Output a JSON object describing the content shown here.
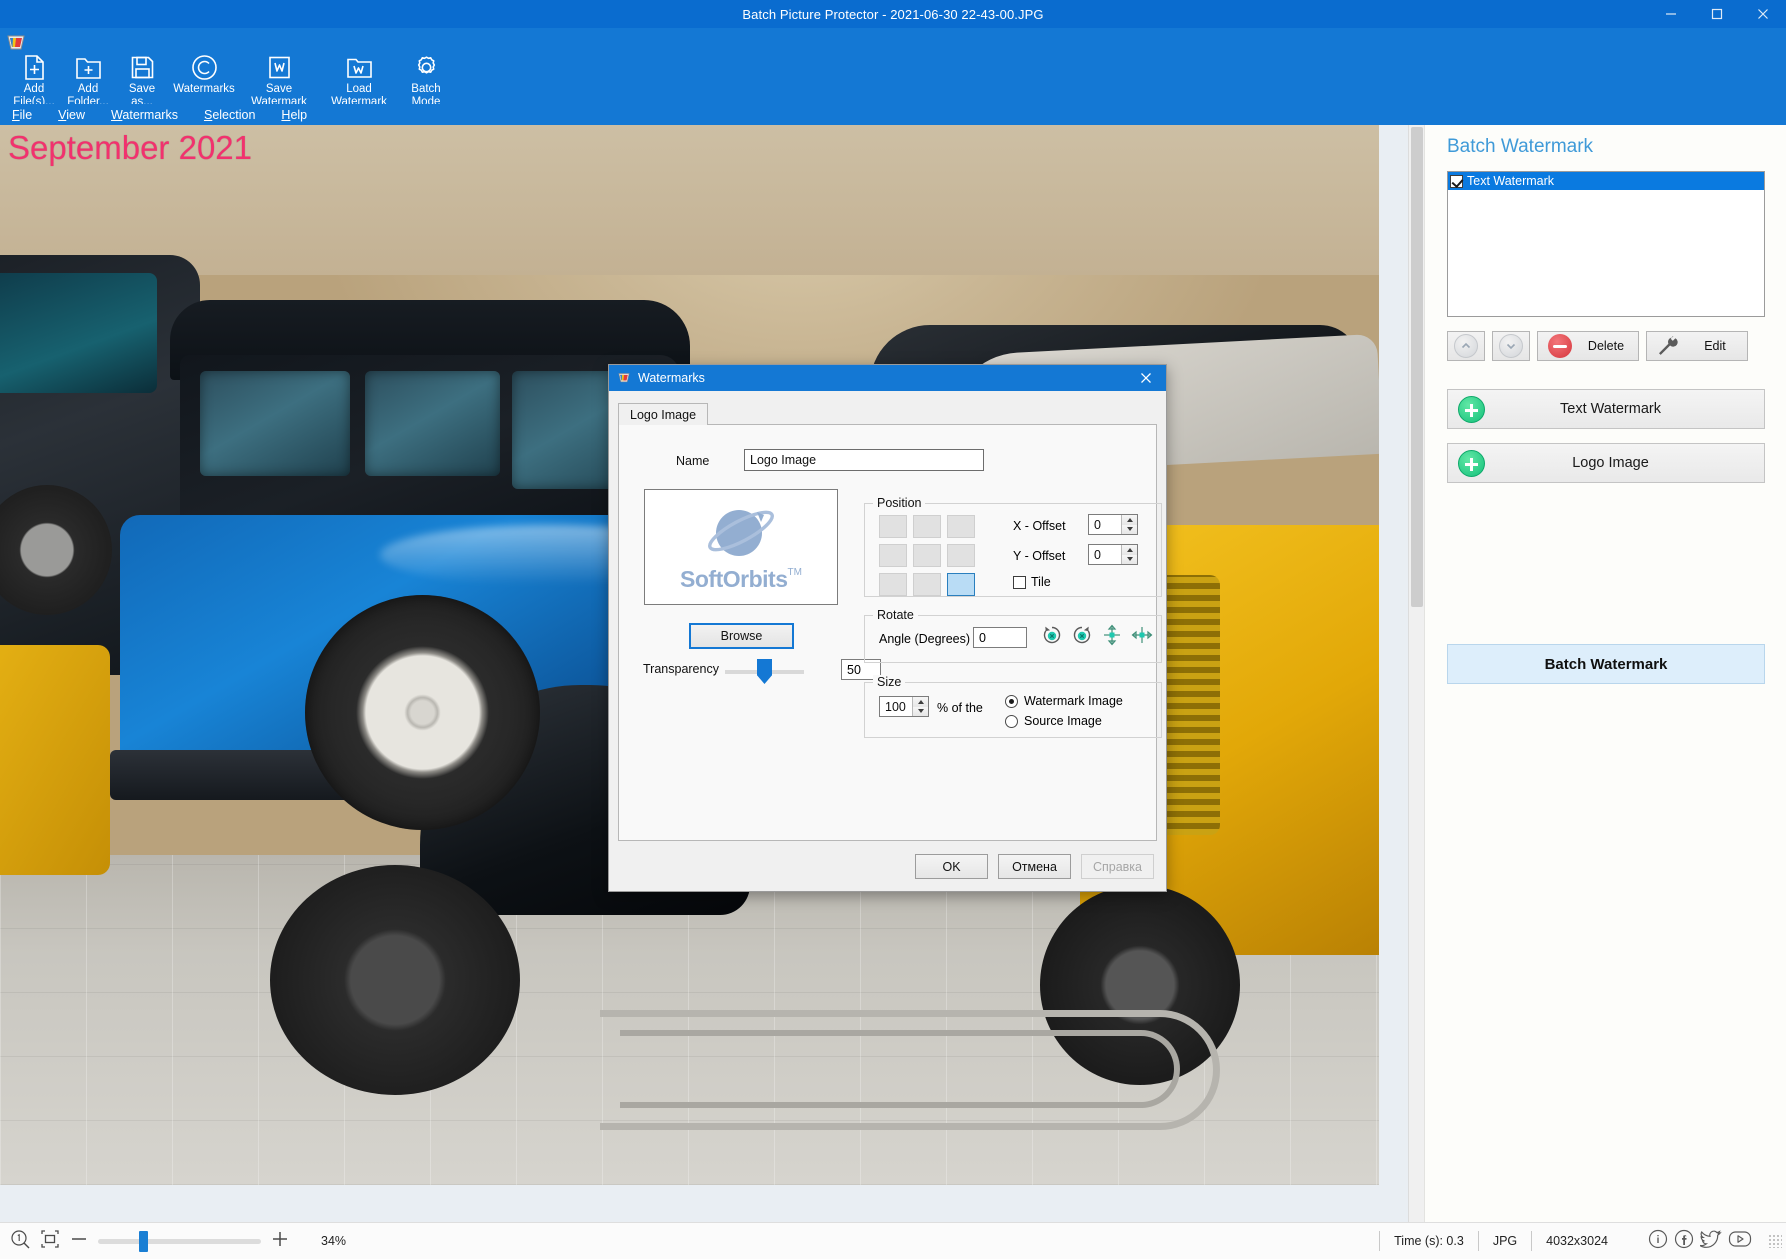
{
  "window": {
    "title": "Batch Picture Protector - 2021-06-30 22-43-00.JPG",
    "app_icon": "app-logo-icon",
    "minimize": "minimize-icon",
    "maximize": "maximize-icon",
    "close": "close-icon"
  },
  "toolbar": {
    "items": [
      {
        "icon": "add-file-icon",
        "label": "Add\nFile(s)..."
      },
      {
        "icon": "add-folder-icon",
        "label": "Add\nFolder..."
      },
      {
        "icon": "save-as-icon",
        "label": "Save\nas..."
      },
      {
        "icon": "copyright-icon",
        "label": "Watermarks"
      },
      {
        "icon": "save-watermark-icon",
        "label": "Save\nWatermark"
      },
      {
        "icon": "load-watermark-icon",
        "label": "Load\nWatermark"
      },
      {
        "icon": "gear-icon",
        "label": "Batch\nMode"
      }
    ]
  },
  "menubar": {
    "items": [
      "File",
      "View",
      "Watermarks",
      "Selection",
      "Help"
    ]
  },
  "canvas": {
    "watermark_overlay_text": "September 2021",
    "watermark_overlay_color": "#f2316e"
  },
  "sidebar": {
    "title": "Batch Watermark",
    "list": [
      {
        "label": "Text Watermark",
        "checked": true,
        "selected": true
      }
    ],
    "list_buttons": [
      {
        "name": "move-up-button",
        "icon": "chevron-up-icon",
        "label": ""
      },
      {
        "name": "move-down-button",
        "icon": "chevron-down-icon",
        "label": ""
      },
      {
        "name": "delete-button",
        "icon": "minus-circle-icon",
        "label": "Delete"
      },
      {
        "name": "edit-button",
        "icon": "wrench-icon",
        "label": "Edit"
      }
    ],
    "add_buttons": [
      {
        "label": "Text Watermark",
        "icon": "plus-circle-icon"
      },
      {
        "label": "Logo Image",
        "icon": "plus-circle-icon"
      }
    ],
    "batch_button": "Batch Watermark"
  },
  "dialog": {
    "title": "Watermarks",
    "icon": "app-logo-icon",
    "close": "close-icon",
    "tab": "Logo Image",
    "name_label": "Name",
    "name_value": "Logo Image",
    "preview_brand": "SoftOrbits",
    "preview_tm": "TM",
    "browse_label": "Browse",
    "transparency_label": "Transparency",
    "transparency_value": "50",
    "position": {
      "group_label": "Position",
      "selected_cell": 8,
      "x_offset_label": "X - Offset",
      "x_offset_value": "0",
      "y_offset_label": "Y - Offset",
      "y_offset_value": "0",
      "tile_label": "Tile",
      "tile_checked": false
    },
    "rotate": {
      "group_label": "Rotate",
      "angle_label": "Angle (Degrees)",
      "angle_value": "0",
      "icons": [
        "rotate-left-icon",
        "rotate-right-icon",
        "flip-vertical-icon",
        "flip-horizontal-icon"
      ]
    },
    "size": {
      "group_label": "Size",
      "value": "100",
      "percent_label": "% of the",
      "options": [
        {
          "label": "Watermark Image",
          "selected": true
        },
        {
          "label": "Source Image",
          "selected": false
        }
      ]
    },
    "buttons": [
      {
        "label": "OK",
        "disabled": false
      },
      {
        "label": "Отмена",
        "disabled": false
      },
      {
        "label": "Справка",
        "disabled": true
      }
    ]
  },
  "statusbar": {
    "zoom_one_icon": "zoom-actual-size-icon",
    "fit_icon": "fit-to-window-icon",
    "minus_icon": "zoom-out-icon",
    "plus_icon": "zoom-in-icon",
    "zoom_percent": "34%",
    "time": "Time (s): 0.3",
    "format": "JPG",
    "dimensions": "4032x3024",
    "social": [
      "info-icon",
      "facebook-icon",
      "twitter-icon",
      "youtube-icon"
    ]
  }
}
